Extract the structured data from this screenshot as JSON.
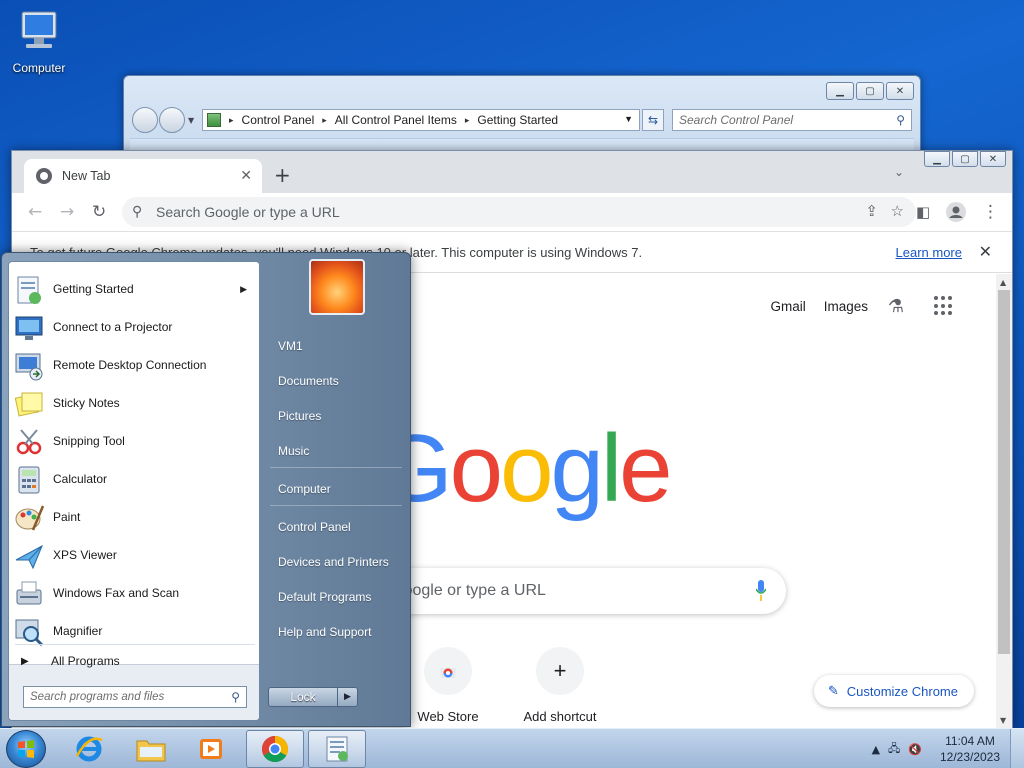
{
  "desktop": {
    "icon_label": "Computer"
  },
  "control_panel": {
    "breadcrumbs": [
      "Control Panel",
      "All Control Panel Items",
      "Getting Started"
    ],
    "search_placeholder": "Search Control Panel",
    "window_buttons": [
      "minimize",
      "maximize",
      "close"
    ]
  },
  "chrome": {
    "tab_title": "New Tab",
    "omnibox_placeholder": "Search Google or type a URL",
    "infobar_text": "To get future Google Chrome updates, you'll need Windows 10 or later. This computer is using Windows 7.",
    "infobar_link": "Learn more",
    "ntp_links": [
      "Gmail",
      "Images"
    ],
    "google_logo": [
      "G",
      "o",
      "o",
      "g",
      "l",
      "e"
    ],
    "google_colors": [
      "#4285f4",
      "#ea4335",
      "#fbbc05",
      "#4285f4",
      "#34a853",
      "#ea4335"
    ],
    "ntp_search_text": "Search Google or type a URL",
    "shortcuts": [
      {
        "label": "Web Store"
      },
      {
        "label": "Add shortcut"
      }
    ],
    "customize_label": "Customize Chrome"
  },
  "start_menu": {
    "programs": [
      {
        "label": "Getting Started",
        "icon": "getting-started-icon",
        "has_submenu": true
      },
      {
        "label": "Connect to a Projector",
        "icon": "projector-icon"
      },
      {
        "label": "Remote Desktop Connection",
        "icon": "remote-desktop-icon"
      },
      {
        "label": "Sticky Notes",
        "icon": "sticky-notes-icon"
      },
      {
        "label": "Snipping Tool",
        "icon": "snipping-tool-icon"
      },
      {
        "label": "Calculator",
        "icon": "calculator-icon"
      },
      {
        "label": "Paint",
        "icon": "paint-icon"
      },
      {
        "label": "XPS Viewer",
        "icon": "xps-viewer-icon"
      },
      {
        "label": "Windows Fax and Scan",
        "icon": "fax-scan-icon"
      },
      {
        "label": "Magnifier",
        "icon": "magnifier-icon"
      }
    ],
    "all_programs": "All Programs",
    "search_placeholder": "Search programs and files",
    "right_items": [
      "VM1",
      "Documents",
      "Pictures",
      "Music",
      "Computer",
      "Control Panel",
      "Devices and Printers",
      "Default Programs",
      "Help and Support"
    ],
    "shutdown_label": "Lock"
  },
  "taskbar": {
    "time": "11:04 AM",
    "date": "12/23/2023"
  }
}
